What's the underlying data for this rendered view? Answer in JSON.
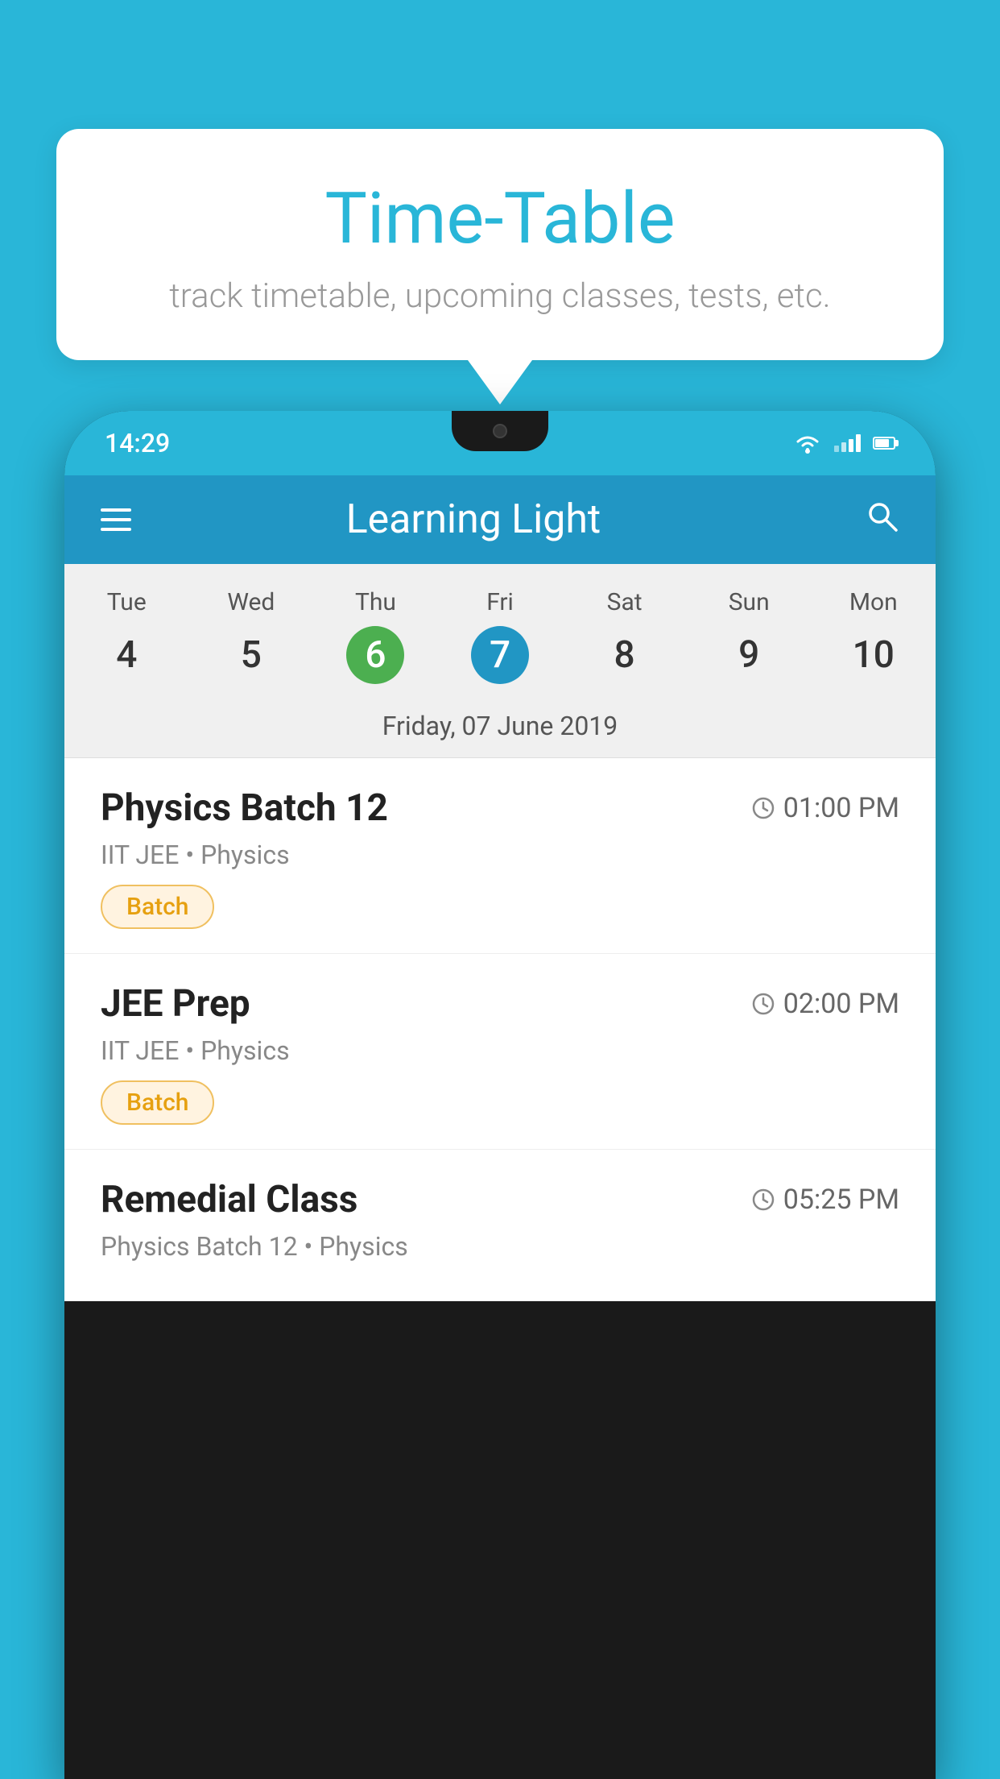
{
  "background_color": "#29b6d8",
  "speech_bubble": {
    "title": "Time-Table",
    "subtitle": "track timetable, upcoming classes, tests, etc."
  },
  "phone": {
    "status_bar": {
      "time": "14:29"
    },
    "app_bar": {
      "title": "Learning Light"
    },
    "calendar": {
      "days": [
        {
          "label": "Tue",
          "number": "4",
          "state": "normal"
        },
        {
          "label": "Wed",
          "number": "5",
          "state": "normal"
        },
        {
          "label": "Thu",
          "number": "6",
          "state": "today"
        },
        {
          "label": "Fri",
          "number": "7",
          "state": "selected"
        },
        {
          "label": "Sat",
          "number": "8",
          "state": "normal"
        },
        {
          "label": "Sun",
          "number": "9",
          "state": "normal"
        },
        {
          "label": "Mon",
          "number": "10",
          "state": "normal"
        }
      ],
      "selected_date_label": "Friday, 07 June 2019"
    },
    "schedule": [
      {
        "title": "Physics Batch 12",
        "time": "01:00 PM",
        "subtitle": "IIT JEE • Physics",
        "badge": "Batch"
      },
      {
        "title": "JEE Prep",
        "time": "02:00 PM",
        "subtitle": "IIT JEE • Physics",
        "badge": "Batch"
      },
      {
        "title": "Remedial Class",
        "time": "05:25 PM",
        "subtitle": "Physics Batch 12 • Physics",
        "badge": null
      }
    ]
  }
}
